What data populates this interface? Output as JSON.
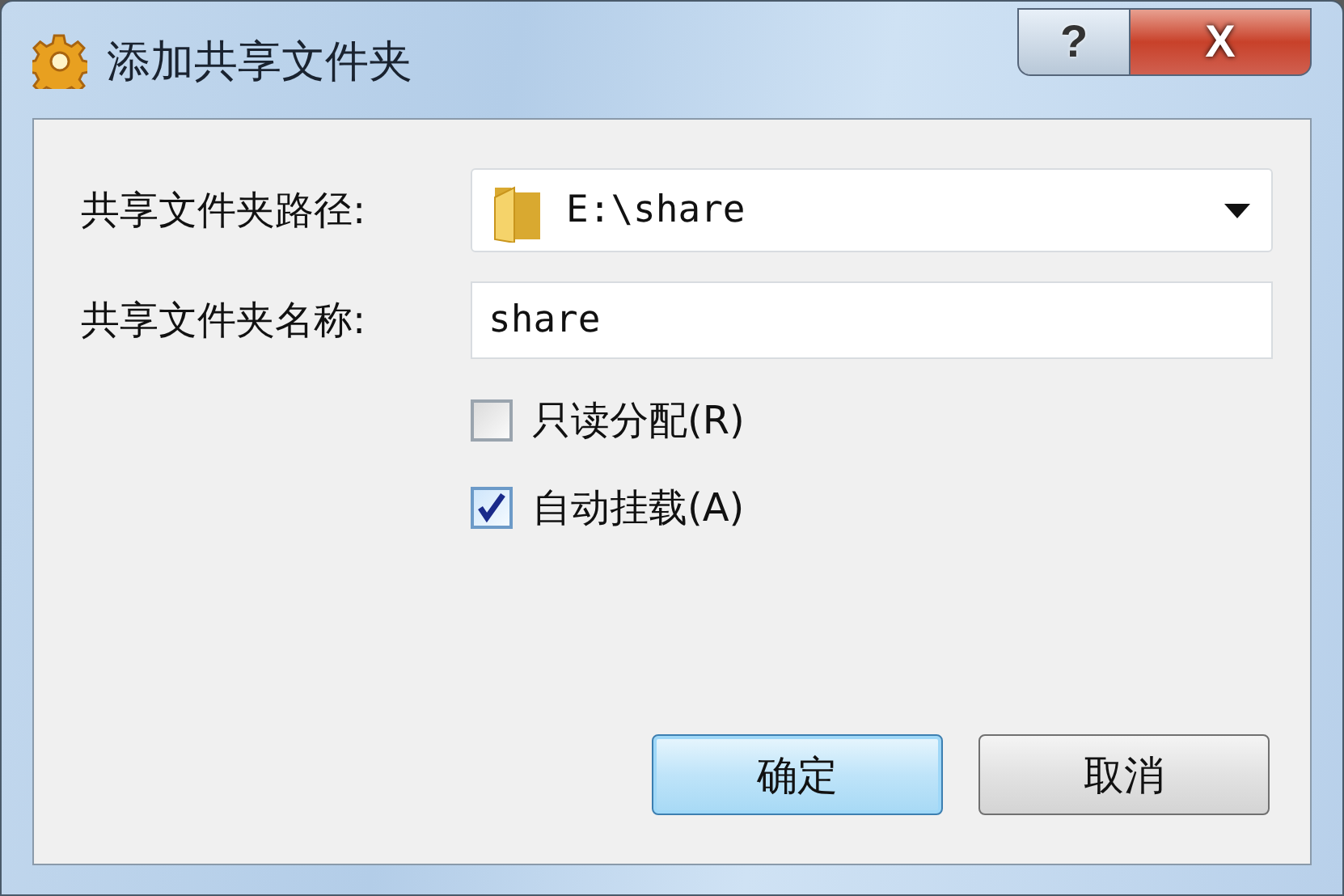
{
  "window": {
    "title": "添加共享文件夹",
    "help_button": "?",
    "close_button": "X"
  },
  "fields": [
    {
      "kind": "combo",
      "label": "共享文件夹路径:",
      "value": "E:\\share"
    },
    {
      "kind": "text",
      "label": "共享文件夹名称:",
      "value": "share"
    }
  ],
  "options": [
    {
      "label": "只读分配(R)",
      "checked": false
    },
    {
      "label": "自动挂载(A)",
      "checked": true
    }
  ],
  "buttons": [
    {
      "label": "确定",
      "default": true
    },
    {
      "label": "取消",
      "default": false
    }
  ]
}
